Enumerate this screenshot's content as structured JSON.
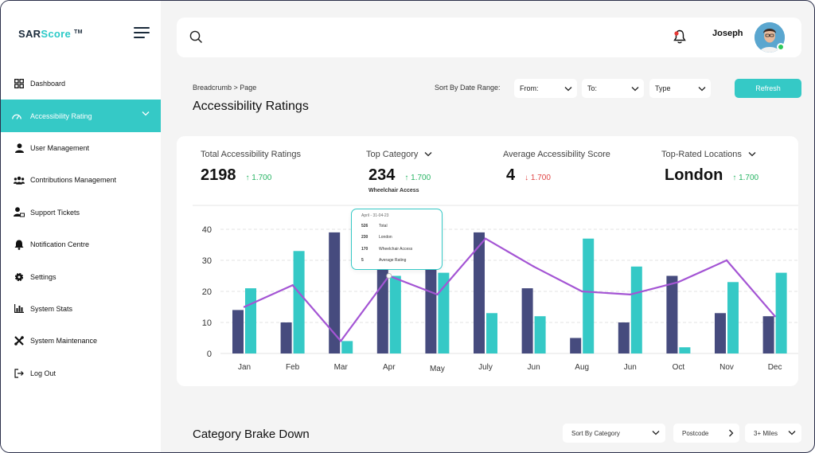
{
  "brand": {
    "name_dark": "SAR",
    "name_accent": "Score",
    "tm": "TM"
  },
  "sidebar": {
    "items": [
      {
        "label": "Dashboard",
        "icon": "dashboard-icon"
      },
      {
        "label": "Accessibility Rating",
        "icon": "gauge-icon",
        "active": true
      },
      {
        "label": "User Management",
        "icon": "user-icon"
      },
      {
        "label": "Contributions Management",
        "icon": "users-group-icon"
      },
      {
        "label": "Support Tickets",
        "icon": "support-user-icon"
      },
      {
        "label": "Notification Centre",
        "icon": "bell-icon"
      },
      {
        "label": "Settings",
        "icon": "gear-icon"
      },
      {
        "label": "System Stats",
        "icon": "bar-stats-icon"
      },
      {
        "label": "System Maintenance",
        "icon": "tools-icon"
      },
      {
        "label": "Log Out",
        "icon": "logout-icon"
      }
    ]
  },
  "topbar": {
    "username": "Joseph"
  },
  "header": {
    "breadcrumb": "Breadcrumb > Page",
    "title": "Accessibility Ratings",
    "sort_label": "Sort By Date Range:",
    "from_label": "From:",
    "to_label": "To:",
    "type_label": "Type",
    "refresh_label": "Refresh"
  },
  "stats": [
    {
      "label": "Total Accessibility Ratings",
      "value": "2198",
      "change": "1.700",
      "direction": "up",
      "sub": ""
    },
    {
      "label": "Top Category",
      "value": "234",
      "change": "1.700",
      "direction": "up",
      "sub": "Wheelchair Access",
      "dropdown": true
    },
    {
      "label": "Average Accessibility Score",
      "value": "4",
      "change": "1.700",
      "direction": "down",
      "sub": ""
    },
    {
      "label": "Top-Rated Locations",
      "value": "London",
      "change": "1.700",
      "direction": "up",
      "sub": "",
      "dropdown": true
    }
  ],
  "tooltip": {
    "title": "April - 31-04-23",
    "rows": [
      {
        "n": "526",
        "label": "Total"
      },
      {
        "n": "230",
        "label": "London"
      },
      {
        "n": "170",
        "label": "Wheelchair Access"
      },
      {
        "n": "5",
        "label": "Average Rating"
      }
    ]
  },
  "chart_data": {
    "type": "bar",
    "categories": [
      "Jan",
      "Feb",
      "Mar",
      "Apr",
      "May",
      "July",
      "Jun",
      "Aug",
      "Jun",
      "Oct",
      "Nov",
      "Dec"
    ],
    "series": [
      {
        "type": "bar",
        "color": "#464b7e",
        "values": [
          14,
          10,
          39,
          29,
          29,
          39,
          21,
          5,
          10,
          25,
          13,
          12
        ]
      },
      {
        "type": "bar",
        "color": "#35c9c6",
        "values": [
          21,
          33,
          4,
          25,
          26,
          13,
          12,
          37,
          28,
          2,
          23,
          26
        ]
      },
      {
        "type": "line",
        "color": "#a455d4",
        "values": [
          15,
          22,
          4,
          25,
          19,
          37,
          28,
          20,
          19,
          23,
          30,
          12
        ]
      }
    ],
    "yticks": [
      0,
      10,
      20,
      30,
      40
    ],
    "ylim": [
      0,
      40
    ],
    "grid": true
  },
  "breakdown": {
    "title": "Category Brake Down",
    "sort_category_label": "Sort By Category",
    "postcode_label": "Postcode",
    "miles_label": "3+ Miles"
  },
  "colors": {
    "accent": "#35c9c6",
    "navy": "#464b7e",
    "line": "#a455d4",
    "up": "#27b463",
    "down": "#e04444"
  }
}
